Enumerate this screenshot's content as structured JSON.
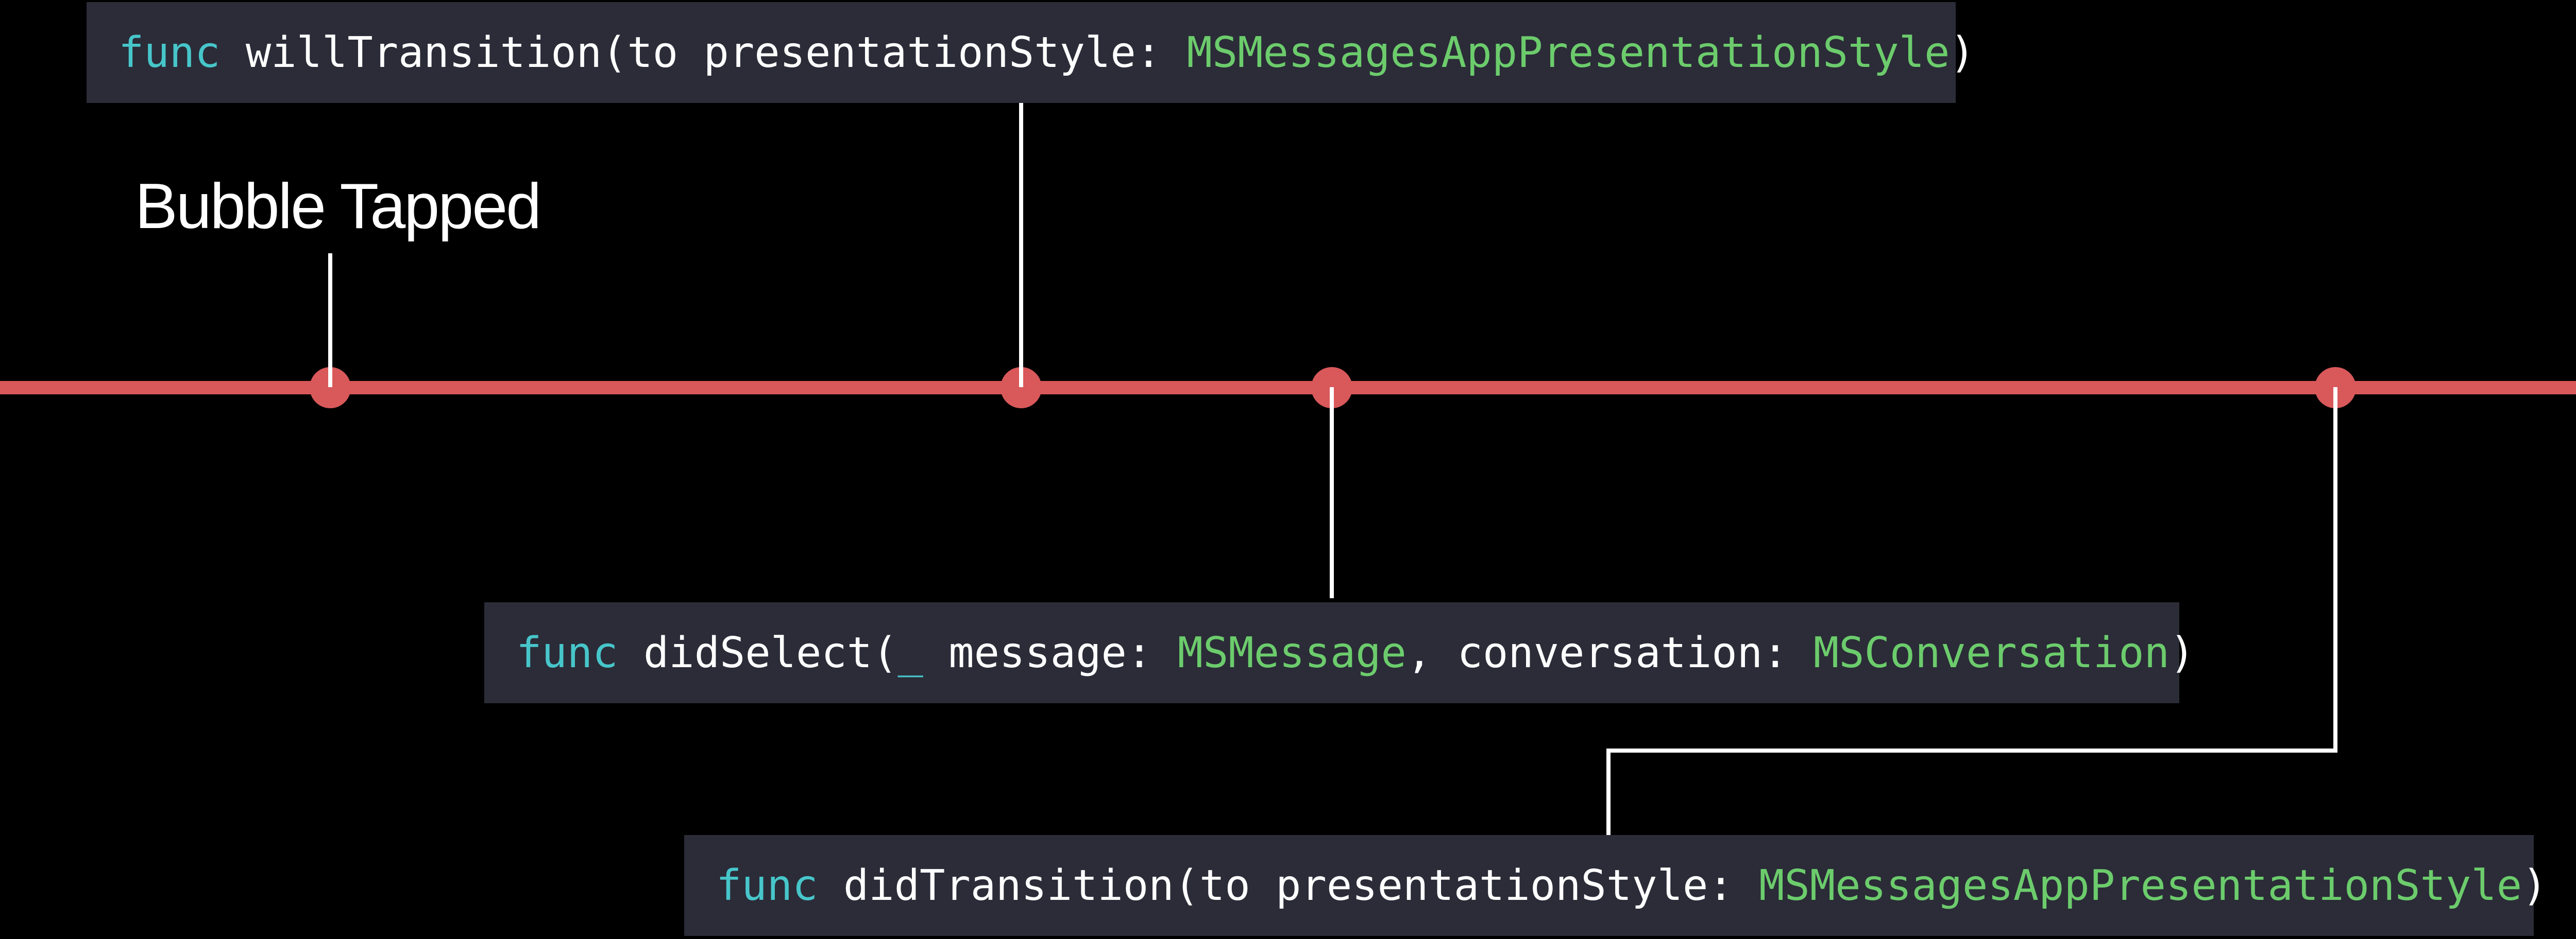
{
  "event_label": "Bubble Tapped",
  "colors": {
    "background": "#000000",
    "timeline": "#d9585a",
    "code_box": "#2b2c38",
    "keyword": "#47c6ca",
    "type": "#6ccc6c",
    "text": "#ffffff"
  },
  "callbacks": {
    "will_transition": {
      "keyword": "func",
      "name_part": " willTransition(to presentationStyle: ",
      "type": "MSMessagesAppPresentationStyle",
      "close": ")"
    },
    "did_select": {
      "keyword": "func",
      "name_part": " didSelect(",
      "underscore": "_",
      "param1": " message: ",
      "type1": "MSMessage",
      "param2": ", conversation: ",
      "type2": "MSConversation",
      "close": ")"
    },
    "did_transition": {
      "keyword": "func",
      "name_part": " didTransition(to presentationStyle: ",
      "type": "MSMessagesAppPresentationStyle",
      "close": ")"
    }
  }
}
